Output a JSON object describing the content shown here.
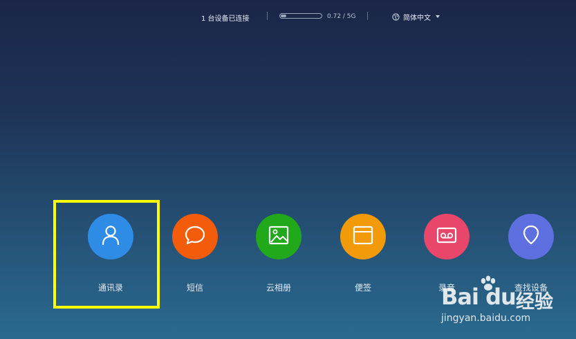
{
  "topbar": {
    "device_status": "1 台设备已连接",
    "storage": {
      "text": "0.72 / 5G",
      "used_fraction": 0.144
    },
    "language": {
      "selected": "简体中文",
      "icon": "globe-icon"
    }
  },
  "apps": [
    {
      "label": "通讯录",
      "color": "#2e8be6",
      "icon": "person-icon"
    },
    {
      "label": "短信",
      "color": "#f25c0a",
      "icon": "chat-bubble-icon"
    },
    {
      "label": "云相册",
      "color": "#22a81b",
      "icon": "image-icon"
    },
    {
      "label": "便签",
      "color": "#f39a0b",
      "icon": "note-icon"
    },
    {
      "label": "录音",
      "color": "#e8466a",
      "icon": "recorder-icon"
    },
    {
      "label": "查找设备",
      "color": "#5e6fe0",
      "icon": "location-pin-icon"
    }
  ],
  "highlight": {
    "color": "#ffff00",
    "target": "通讯录"
  },
  "watermark": {
    "logo": "Bai du",
    "brand": "经验",
    "url": "jingyan.baidu.com"
  }
}
